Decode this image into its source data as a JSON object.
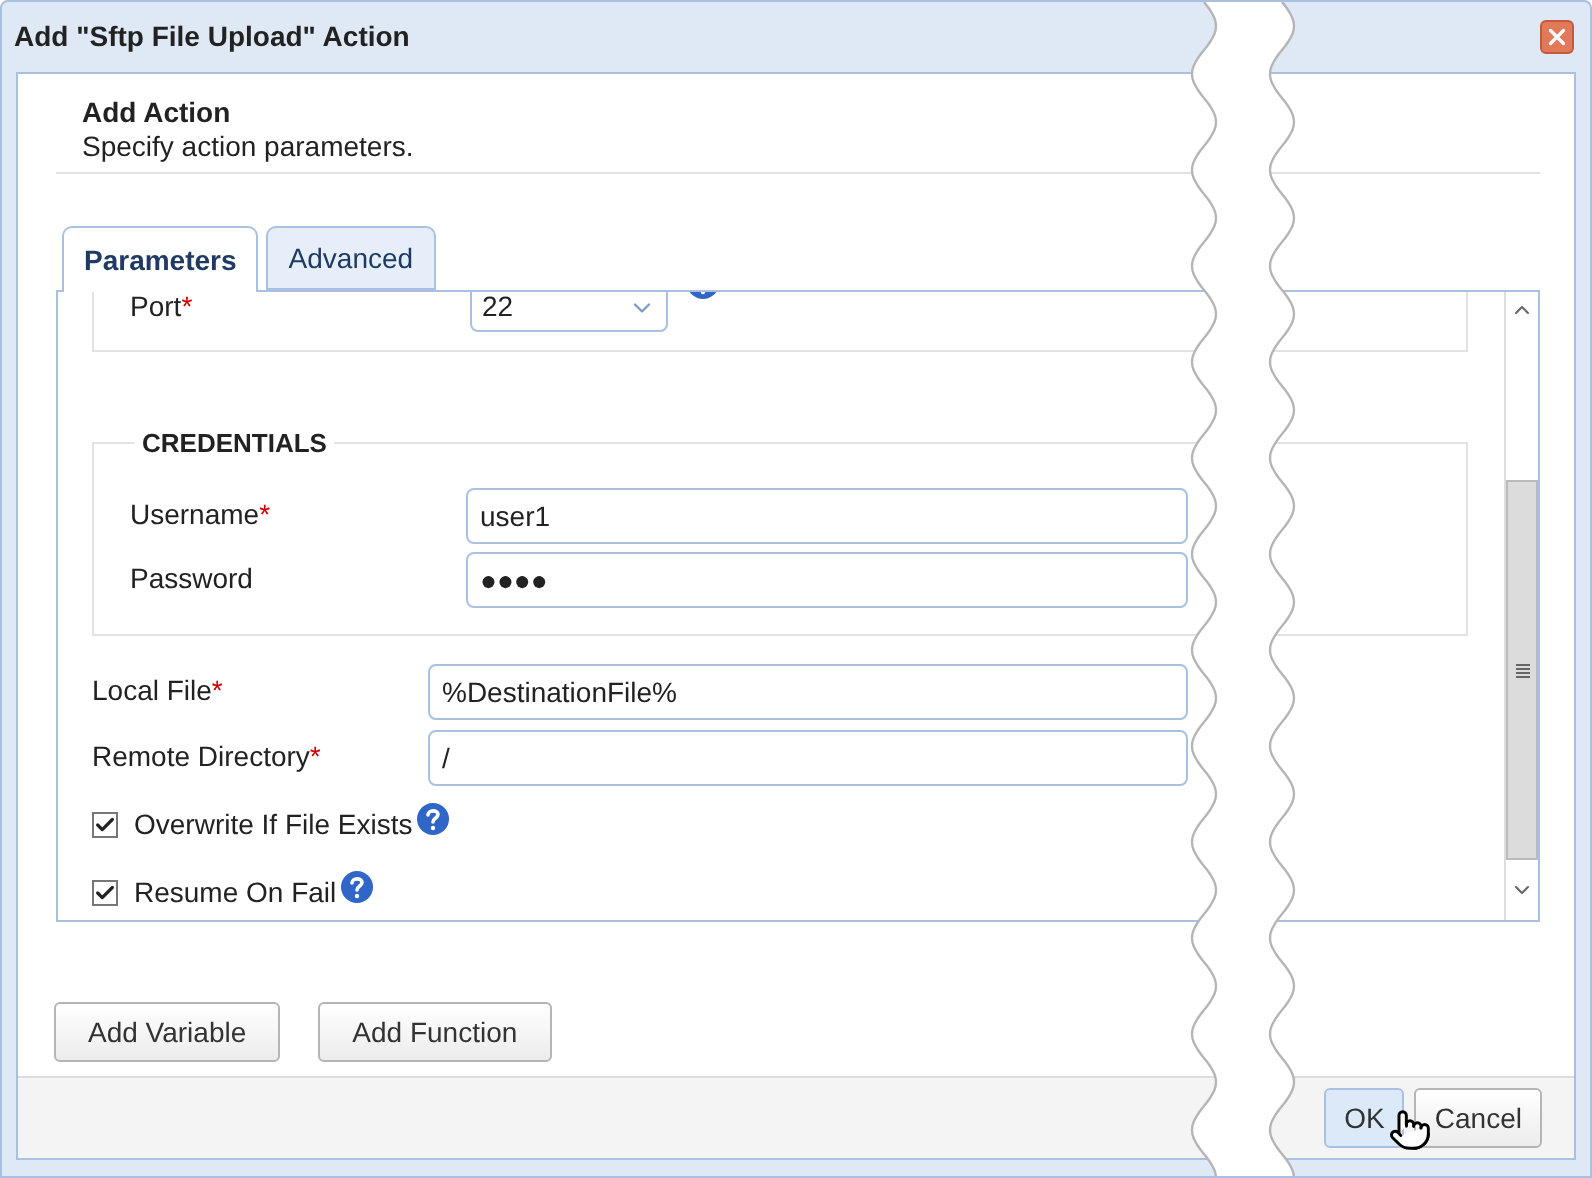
{
  "dialog": {
    "title": "Add \"Sftp File Upload\" Action",
    "header": {
      "title": "Add Action",
      "subtitle": "Specify action parameters."
    }
  },
  "tabs": [
    {
      "label": "Parameters",
      "selected": true
    },
    {
      "label": "Advanced",
      "selected": false
    }
  ],
  "port": {
    "label": "Port",
    "required_mark": "*",
    "value": "22"
  },
  "credentials": {
    "legend": "CREDENTIALS",
    "fields": [
      {
        "label": "Username",
        "required_mark": "*",
        "value": "user1"
      },
      {
        "label": "Password",
        "value": "●●●●"
      }
    ]
  },
  "fields": [
    {
      "label": "Local File",
      "required_mark": "*",
      "value": "%DestinationFile%"
    },
    {
      "label": "Remote Directory",
      "required_mark": "*",
      "value": "/"
    }
  ],
  "options": [
    {
      "label": "Overwrite If File Exists",
      "checked": true
    },
    {
      "label": "Resume On Fail",
      "checked": true
    }
  ],
  "actions": [
    "Add Variable",
    "Add Function"
  ],
  "footer": [
    {
      "label": "OK",
      "hovered": true
    },
    {
      "label": "Cancel",
      "hovered": false
    }
  ]
}
